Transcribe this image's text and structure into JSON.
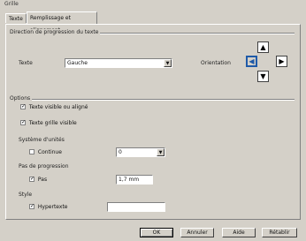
{
  "window": {
    "title": "Grille"
  },
  "tabs": [
    {
      "label": "Texte"
    },
    {
      "label": "Remplissage et alignement"
    }
  ],
  "direction_group": {
    "label": "Direction de progression du texte",
    "text_label": "Texte",
    "text_value": "Gauche",
    "orientation_label": "Orientation",
    "buttons": {
      "up": "▲",
      "left": "◀",
      "right": "▶",
      "down": "▼"
    }
  },
  "options_group": {
    "label": "Options",
    "check_visible": "Texte visible ou aligné",
    "check_grid": "Texte grille visible",
    "system_label": "Système d'unités",
    "continuous_label": "Continue",
    "continuous_value": "0",
    "progress_label": "Pas de progression",
    "pass_label": "Pas",
    "pass_value": "1,7 mm",
    "style_label": "Style",
    "hyper_label": "Hypertexte",
    "hyper_value": ""
  },
  "footer": {
    "ok": "OK",
    "cancel": "Annuler",
    "help": "Aide",
    "reset": "Rétablir"
  }
}
